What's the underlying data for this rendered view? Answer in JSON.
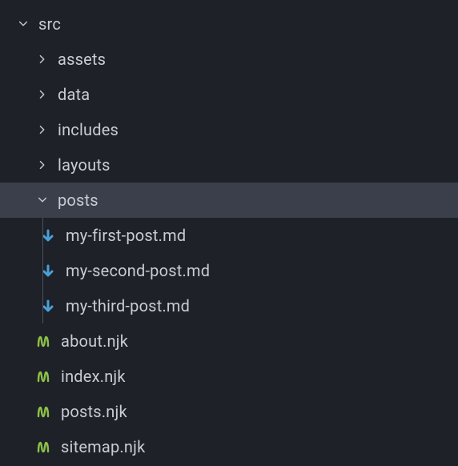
{
  "tree": {
    "root": {
      "label": "src"
    },
    "folders": [
      {
        "label": "assets"
      },
      {
        "label": "data"
      },
      {
        "label": "includes"
      },
      {
        "label": "layouts"
      },
      {
        "label": "posts"
      }
    ],
    "posts_files": [
      {
        "label": "my-first-post.md"
      },
      {
        "label": "my-second-post.md"
      },
      {
        "label": "my-third-post.md"
      }
    ],
    "root_files": [
      {
        "label": "about.njk"
      },
      {
        "label": "index.njk"
      },
      {
        "label": "posts.njk"
      },
      {
        "label": "sitemap.njk"
      }
    ]
  },
  "colors": {
    "md_icon": "#4a9fd8",
    "njk_icon": "#8dc149"
  }
}
